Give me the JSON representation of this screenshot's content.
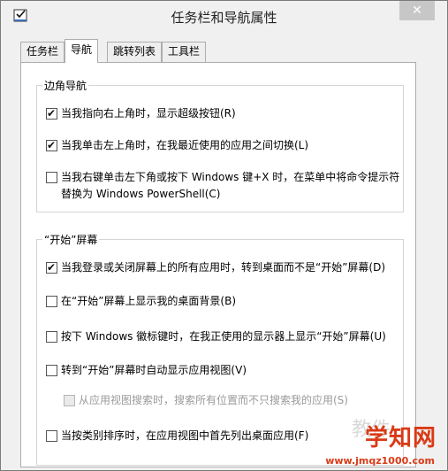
{
  "window": {
    "title": "任务栏和导航属性",
    "close_label": "✕"
  },
  "tabs": [
    {
      "label": "任务栏",
      "active": false
    },
    {
      "label": "导航",
      "active": true
    },
    {
      "label": "跳转列表",
      "active": false
    },
    {
      "label": "工具栏",
      "active": false
    }
  ],
  "corner_nav": {
    "title": "边角导航",
    "options": [
      {
        "label": "当我指向右上角时，显示超级按钮(R)",
        "checked": true
      },
      {
        "label": "当我单击左上角时，在我最近使用的应用之间切换(L)",
        "checked": true
      },
      {
        "label": "当我右键单击左下角或按下 Windows 键+X 时，在菜单中将命令提示符",
        "label2": "替换为 Windows PowerShell(C)",
        "checked": false
      }
    ]
  },
  "start_screen": {
    "title": "“开始”屏幕",
    "options": [
      {
        "label": "当我登录或关闭屏幕上的所有应用时，转到桌面而不是“开始”屏幕(D)",
        "checked": true
      },
      {
        "label": "在“开始”屏幕上显示我的桌面背景(B)",
        "checked": false
      },
      {
        "label": "按下 Windows 徽标键时，在我正使用的显示器上显示“开始”屏幕(U)",
        "checked": false
      },
      {
        "label": "转到“开始”屏幕时自动显示应用视图(V)",
        "checked": false
      },
      {
        "label": "从应用视图搜索时，搜索所有位置而不只搜索我的应用(S)",
        "checked": false,
        "disabled": true
      },
      {
        "label": "当按类别排序时，在应用视图中首先列出桌面应用(F)",
        "checked": false
      }
    ]
  },
  "watermark": {
    "faint": "教件",
    "logo": "学知网",
    "url": "www.jmqz1000.com"
  }
}
